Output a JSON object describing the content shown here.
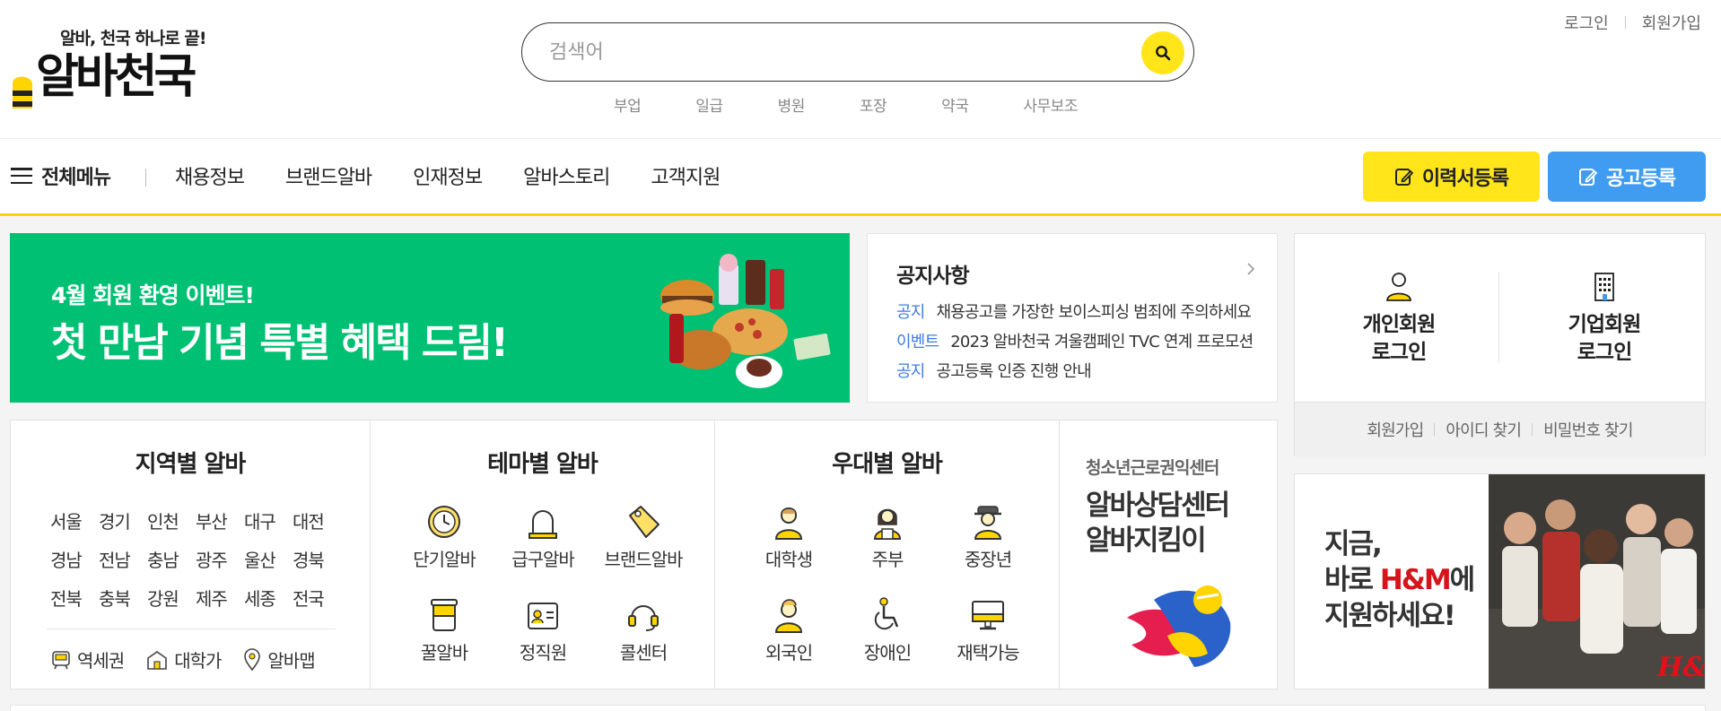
{
  "header": {
    "logo_slogan": "알바, 천국 하나로 끝!",
    "logo_name": "알바천국",
    "search_placeholder": "검색어",
    "keywords": [
      "부업",
      "일급",
      "병원",
      "포장",
      "약국",
      "사무보조"
    ],
    "top_links": {
      "login": "로그인",
      "signup": "회원가입"
    },
    "search_icon": "search-icon"
  },
  "gnb": {
    "all_menu": "전체메뉴",
    "items": [
      "채용정보",
      "브랜드알바",
      "인재정보",
      "알바스토리",
      "고객지원"
    ],
    "resume_button": "이력서등록",
    "post_button": "공고등록",
    "colors": {
      "accent": "#ffd400",
      "blue": "#3f9cf0"
    }
  },
  "banner": {
    "subtitle": "4월 회원 환영 이벤트!",
    "title": "첫 만남 기념 특별 혜택 드림!",
    "background": "#00c073"
  },
  "notice": {
    "title": "공지사항",
    "rows": [
      {
        "tag": "공지",
        "text": "채용공고를 가장한 보이스피싱 범죄에 주의하세요"
      },
      {
        "tag": "이벤트",
        "text": "2023 알바천국 겨울캠페인 TVC 연계 프로모션"
      },
      {
        "tag": "공지",
        "text": "공고등록 인증 진행 안내"
      }
    ]
  },
  "login": {
    "personal": "개인회원\n로그인",
    "company": "기업회원\n로그인",
    "links": [
      "회원가입",
      "아이디 찾기",
      "비밀번호 찾기"
    ]
  },
  "categories": {
    "region": {
      "title": "지역별 알바",
      "areas": [
        "서울",
        "경기",
        "인천",
        "부산",
        "대구",
        "대전",
        "경남",
        "전남",
        "충남",
        "광주",
        "울산",
        "경북",
        "전북",
        "충북",
        "강원",
        "제주",
        "세종",
        "전국"
      ],
      "links": [
        "역세권",
        "대학가",
        "알바맵"
      ]
    },
    "theme": {
      "title": "테마별 알바",
      "items": [
        "단기알바",
        "급구알바",
        "브랜드알바",
        "꿀알바",
        "정직원",
        "콜센터"
      ]
    },
    "benefit": {
      "title": "우대별 알바",
      "items": [
        "대학생",
        "주부",
        "중장년",
        "외국인",
        "장애인",
        "재택가능"
      ]
    },
    "promo": {
      "subtitle": "청소년근로권익센터",
      "title": "알바상담센터\n알바지킴이"
    }
  },
  "ad": {
    "line1": "지금,",
    "line2_prefix": "바로 ",
    "line2_brand": "H&M",
    "line2_suffix": "에",
    "line3": "지원하세요!",
    "brand_color": "#d5141b"
  }
}
